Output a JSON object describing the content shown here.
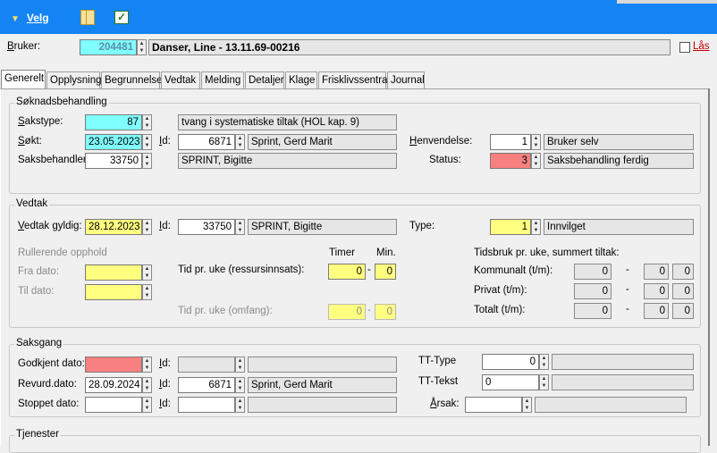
{
  "toolbar": {
    "menu_label": "Velg",
    "icons": [
      "binder-icon",
      "checklist-icon"
    ]
  },
  "bruker": {
    "label": "Bruker:",
    "id": "204481",
    "name": "Danser, Line - 13.11.69-00216",
    "las_label": "Lås"
  },
  "tabs": [
    "Generelt",
    "Opplysning",
    "Begrunnelse",
    "Vedtak",
    "Melding",
    "Detaljer",
    "Klage",
    "Frisklivssentral",
    "Journal"
  ],
  "soknad": {
    "title": "Søknadsbehandling",
    "sakstype_label": "Sakstype:",
    "sakstype_value": "87",
    "sakstype_text": "tvang i systematiske tiltak (HOL kap. 9)",
    "sokt_label": "Søkt:",
    "sokt_value": "23.05.2023",
    "id_label": "Id:",
    "id_value": "6871",
    "id_text": "Sprint, Gerd Marit",
    "henvendelse_label": "Henvendelse:",
    "henvendelse_value": "1",
    "henvendelse_text": "Bruker selv",
    "saksbehandler_label": "Saksbehandler:",
    "saksbehandler_value": "33750",
    "saksbehandler_text": "SPRINT, Bigitte",
    "status_label": "Status:",
    "status_value": "3",
    "status_text": "Saksbehandling ferdig"
  },
  "vedtak": {
    "title": "Vedtak",
    "gyldig_label": "Vedtak gyldig:",
    "gyldig_value": "28.12.2023",
    "id_label": "Id:",
    "id_value": "33750",
    "id_text": "SPRINT, Bigitte",
    "type_label": "Type:",
    "type_value": "1",
    "type_text": "Innvilget",
    "rullerende_label": "Rullerende opphold",
    "fra_label": "Fra dato:",
    "til_label": "Til dato:",
    "timer_label": "Timer",
    "min_label": "Min.",
    "tid_ressurs_label": "Tid pr. uke (ressursinnsats):",
    "tid_ressurs_timer": "0",
    "tid_ressurs_min": "0",
    "tid_omfang_label": "Tid pr. uke (omfang):",
    "tid_omfang_timer": "0",
    "tid_omfang_min": "0",
    "tidsbruk_label": "Tidsbruk pr. uke, summert tiltak:",
    "kommunalt_label": "Kommunalt (t/m):",
    "privat_label": "Privat (t/m):",
    "totalt_label": "Totalt (t/m):",
    "kommunalt": [
      "0",
      "0",
      "0"
    ],
    "privat": [
      "0",
      "0",
      "0"
    ],
    "totalt": [
      "0",
      "0",
      "0"
    ],
    "dash": "-"
  },
  "saksgang": {
    "title": "Saksgang",
    "godkjent_label": "Godkjent dato:",
    "revurd_label": "Revurd.dato:",
    "revurd_value": "28.09.2024",
    "revurd_id": "6871",
    "revurd_text": "Sprint, Gerd Marit",
    "stoppet_label": "Stoppet dato:",
    "id_label": "Id:",
    "tt_type_label": "TT-Type",
    "tt_type_value": "0",
    "tt_tekst_label": "TT-Tekst",
    "tt_tekst_value": "0",
    "arsak_label": "Årsak:"
  },
  "tjenester": {
    "title": "Tjenester"
  },
  "colors": {
    "title_bar": "#1484f4",
    "cyan_field": "#80ffff",
    "yellow_field": "#ffff80",
    "red_field": "#f88080"
  }
}
